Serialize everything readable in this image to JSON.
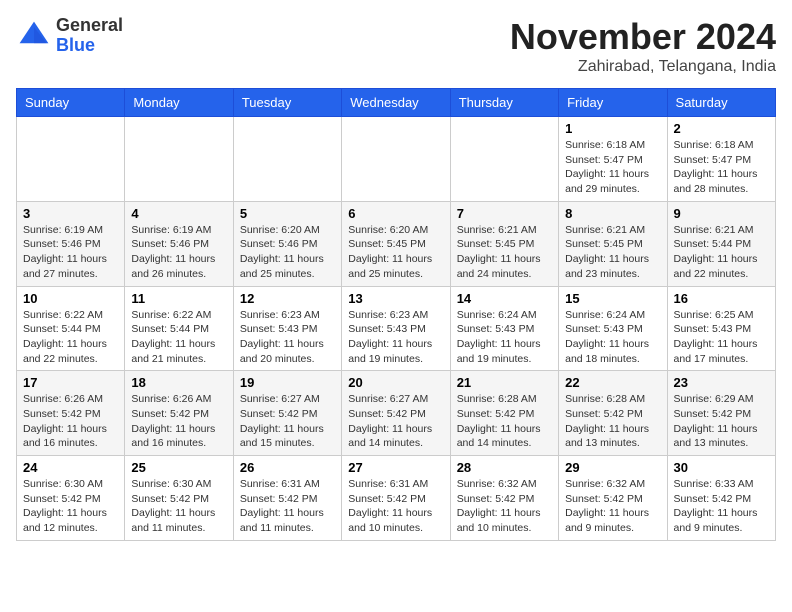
{
  "header": {
    "logo_line1": "General",
    "logo_line2": "Blue",
    "month": "November 2024",
    "location": "Zahirabad, Telangana, India"
  },
  "weekdays": [
    "Sunday",
    "Monday",
    "Tuesday",
    "Wednesday",
    "Thursday",
    "Friday",
    "Saturday"
  ],
  "weeks": [
    [
      {
        "day": "",
        "info": ""
      },
      {
        "day": "",
        "info": ""
      },
      {
        "day": "",
        "info": ""
      },
      {
        "day": "",
        "info": ""
      },
      {
        "day": "",
        "info": ""
      },
      {
        "day": "1",
        "info": "Sunrise: 6:18 AM\nSunset: 5:47 PM\nDaylight: 11 hours\nand 29 minutes."
      },
      {
        "day": "2",
        "info": "Sunrise: 6:18 AM\nSunset: 5:47 PM\nDaylight: 11 hours\nand 28 minutes."
      }
    ],
    [
      {
        "day": "3",
        "info": "Sunrise: 6:19 AM\nSunset: 5:46 PM\nDaylight: 11 hours\nand 27 minutes."
      },
      {
        "day": "4",
        "info": "Sunrise: 6:19 AM\nSunset: 5:46 PM\nDaylight: 11 hours\nand 26 minutes."
      },
      {
        "day": "5",
        "info": "Sunrise: 6:20 AM\nSunset: 5:46 PM\nDaylight: 11 hours\nand 25 minutes."
      },
      {
        "day": "6",
        "info": "Sunrise: 6:20 AM\nSunset: 5:45 PM\nDaylight: 11 hours\nand 25 minutes."
      },
      {
        "day": "7",
        "info": "Sunrise: 6:21 AM\nSunset: 5:45 PM\nDaylight: 11 hours\nand 24 minutes."
      },
      {
        "day": "8",
        "info": "Sunrise: 6:21 AM\nSunset: 5:45 PM\nDaylight: 11 hours\nand 23 minutes."
      },
      {
        "day": "9",
        "info": "Sunrise: 6:21 AM\nSunset: 5:44 PM\nDaylight: 11 hours\nand 22 minutes."
      }
    ],
    [
      {
        "day": "10",
        "info": "Sunrise: 6:22 AM\nSunset: 5:44 PM\nDaylight: 11 hours\nand 22 minutes."
      },
      {
        "day": "11",
        "info": "Sunrise: 6:22 AM\nSunset: 5:44 PM\nDaylight: 11 hours\nand 21 minutes."
      },
      {
        "day": "12",
        "info": "Sunrise: 6:23 AM\nSunset: 5:43 PM\nDaylight: 11 hours\nand 20 minutes."
      },
      {
        "day": "13",
        "info": "Sunrise: 6:23 AM\nSunset: 5:43 PM\nDaylight: 11 hours\nand 19 minutes."
      },
      {
        "day": "14",
        "info": "Sunrise: 6:24 AM\nSunset: 5:43 PM\nDaylight: 11 hours\nand 19 minutes."
      },
      {
        "day": "15",
        "info": "Sunrise: 6:24 AM\nSunset: 5:43 PM\nDaylight: 11 hours\nand 18 minutes."
      },
      {
        "day": "16",
        "info": "Sunrise: 6:25 AM\nSunset: 5:43 PM\nDaylight: 11 hours\nand 17 minutes."
      }
    ],
    [
      {
        "day": "17",
        "info": "Sunrise: 6:26 AM\nSunset: 5:42 PM\nDaylight: 11 hours\nand 16 minutes."
      },
      {
        "day": "18",
        "info": "Sunrise: 6:26 AM\nSunset: 5:42 PM\nDaylight: 11 hours\nand 16 minutes."
      },
      {
        "day": "19",
        "info": "Sunrise: 6:27 AM\nSunset: 5:42 PM\nDaylight: 11 hours\nand 15 minutes."
      },
      {
        "day": "20",
        "info": "Sunrise: 6:27 AM\nSunset: 5:42 PM\nDaylight: 11 hours\nand 14 minutes."
      },
      {
        "day": "21",
        "info": "Sunrise: 6:28 AM\nSunset: 5:42 PM\nDaylight: 11 hours\nand 14 minutes."
      },
      {
        "day": "22",
        "info": "Sunrise: 6:28 AM\nSunset: 5:42 PM\nDaylight: 11 hours\nand 13 minutes."
      },
      {
        "day": "23",
        "info": "Sunrise: 6:29 AM\nSunset: 5:42 PM\nDaylight: 11 hours\nand 13 minutes."
      }
    ],
    [
      {
        "day": "24",
        "info": "Sunrise: 6:30 AM\nSunset: 5:42 PM\nDaylight: 11 hours\nand 12 minutes."
      },
      {
        "day": "25",
        "info": "Sunrise: 6:30 AM\nSunset: 5:42 PM\nDaylight: 11 hours\nand 11 minutes."
      },
      {
        "day": "26",
        "info": "Sunrise: 6:31 AM\nSunset: 5:42 PM\nDaylight: 11 hours\nand 11 minutes."
      },
      {
        "day": "27",
        "info": "Sunrise: 6:31 AM\nSunset: 5:42 PM\nDaylight: 11 hours\nand 10 minutes."
      },
      {
        "day": "28",
        "info": "Sunrise: 6:32 AM\nSunset: 5:42 PM\nDaylight: 11 hours\nand 10 minutes."
      },
      {
        "day": "29",
        "info": "Sunrise: 6:32 AM\nSunset: 5:42 PM\nDaylight: 11 hours\nand 9 minutes."
      },
      {
        "day": "30",
        "info": "Sunrise: 6:33 AM\nSunset: 5:42 PM\nDaylight: 11 hours\nand 9 minutes."
      }
    ]
  ]
}
